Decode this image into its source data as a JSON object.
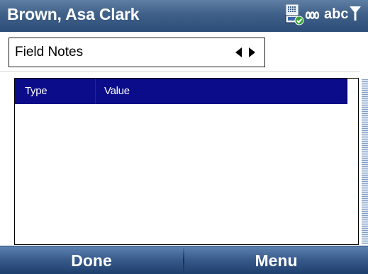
{
  "title_bar": {
    "title": "Brown, Asa Clark",
    "input_mode": "abc",
    "icons": [
      "network-connected-icon",
      "signal-antenna-icon"
    ]
  },
  "combo": {
    "selected": "Field Notes",
    "prev_icon": "left-arrow-icon",
    "next_icon": "right-arrow-icon"
  },
  "list": {
    "columns": [
      "Type",
      "Value"
    ],
    "rows": []
  },
  "softkeys": {
    "left": "Done",
    "right": "Menu"
  },
  "colors": {
    "title_bar": "#3f6088",
    "list_header": "#0b0c8a",
    "softkey_bar": "#37598a"
  }
}
